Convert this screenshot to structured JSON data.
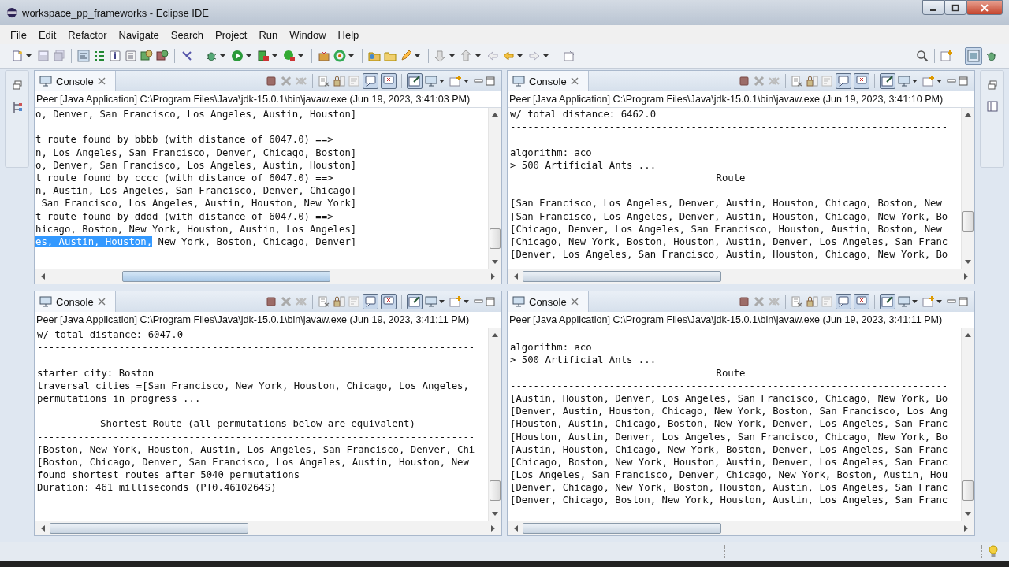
{
  "window": {
    "title": "workspace_pp_frameworks - Eclipse IDE"
  },
  "menu": [
    "File",
    "Edit",
    "Refactor",
    "Navigate",
    "Search",
    "Project",
    "Run",
    "Window",
    "Help"
  ],
  "consoles": [
    {
      "tab": "Console",
      "header": "Peer [Java Application] C:\\Program Files\\Java\\jdk-15.0.1\\bin\\javaw.exe  (Jun 19, 2023, 3:41:03 PM)",
      "scrolled_right": true,
      "show_stdout": true,
      "show_stderr": true,
      "pinned": true,
      "lines": [
        {
          "kind": "output",
          "text": "o, Denver, San Francisco, Los Angeles, Austin, Houston]"
        },
        {
          "kind": "blank"
        },
        {
          "kind": "output",
          "text": "t route found by bbbb (with distance of 6047.0) ==>"
        },
        {
          "kind": "output",
          "text": "n, Los Angeles, San Francisco, Denver, Chicago, Boston]"
        },
        {
          "kind": "output",
          "text": "o, Denver, San Francisco, Los Angeles, Austin, Houston]"
        },
        {
          "kind": "output",
          "text": "t route found by cccc (with distance of 6047.0) ==>"
        },
        {
          "kind": "output",
          "text": "n, Austin, Los Angeles, San Francisco, Denver, Chicago]"
        },
        {
          "kind": "output",
          "text": " San Francisco, Los Angeles, Austin, Houston, New York]"
        },
        {
          "kind": "output",
          "text": "t route found by dddd (with distance of 6047.0) ==>"
        },
        {
          "kind": "output",
          "text": "hicago, Boston, New York, Houston, Austin, Los Angeles]"
        },
        {
          "kind": "output",
          "selected_text": "es, Austin, Houston,",
          "text": " New York, Boston, Chicago, Denver]"
        }
      ]
    },
    {
      "tab": "Console",
      "header": "Peer [Java Application] C:\\Program Files\\Java\\jdk-15.0.1\\bin\\javaw.exe  (Jun 19, 2023, 3:41:10 PM)",
      "scrolled_right": false,
      "show_stdout": true,
      "show_stderr": true,
      "pinned": true,
      "lines": [
        {
          "kind": "output",
          "text": "w/ total distance: 6462.0"
        },
        {
          "kind": "output",
          "text": "---------------------------------------------------------------------------"
        },
        {
          "kind": "blank"
        },
        {
          "kind": "output",
          "text": "algorithm: aco"
        },
        {
          "kind": "output",
          "text": "> 500 Artificial Ants ..."
        },
        {
          "kind": "centered",
          "text": "Route"
        },
        {
          "kind": "output",
          "text": "---------------------------------------------------------------------------"
        },
        {
          "kind": "output",
          "text": "[San Francisco, Los Angeles, Denver, Austin, Houston, Chicago, Boston, New"
        },
        {
          "kind": "output",
          "text": "[San Francisco, Los Angeles, Denver, Austin, Houston, Chicago, New York, Bo"
        },
        {
          "kind": "output",
          "text": "[Chicago, Denver, Los Angeles, San Francisco, Houston, Austin, Boston, New"
        },
        {
          "kind": "output",
          "text": "[Chicago, New York, Boston, Houston, Austin, Denver, Los Angeles, San Franc"
        },
        {
          "kind": "output",
          "text": "[Denver, Los Angeles, San Francisco, Austin, Houston, Chicago, New York, Bo"
        }
      ]
    },
    {
      "tab": "Console",
      "header": "Peer [Java Application] C:\\Program Files\\Java\\jdk-15.0.1\\bin\\javaw.exe  (Jun 19, 2023, 3:41:11 PM)",
      "scrolled_right": false,
      "show_stdout": true,
      "show_stderr": true,
      "pinned": true,
      "lines": [
        {
          "kind": "output",
          "text": "w/ total distance: 6047.0"
        },
        {
          "kind": "output",
          "text": "---------------------------------------------------------------------------"
        },
        {
          "kind": "blank"
        },
        {
          "kind": "output",
          "text": "starter city: Boston"
        },
        {
          "kind": "output",
          "text": "traversal cities =[San Francisco, New York, Houston, Chicago, Los Angeles,"
        },
        {
          "kind": "output",
          "text": "permutations in progress ..."
        },
        {
          "kind": "blank"
        },
        {
          "kind": "centered",
          "text": "Shortest Route (all permutations below are equivalent)"
        },
        {
          "kind": "output",
          "text": "---------------------------------------------------------------------------"
        },
        {
          "kind": "output",
          "text": "[Boston, New York, Houston, Austin, Los Angeles, San Francisco, Denver, Chi"
        },
        {
          "kind": "output",
          "text": "[Boston, Chicago, Denver, San Francisco, Los Angeles, Austin, Houston, New"
        },
        {
          "kind": "output",
          "text": "found shortest routes after 5040 permutations"
        },
        {
          "kind": "output",
          "text": "Duration: 461 milliseconds (PT0.4610264S)"
        }
      ]
    },
    {
      "tab": "Console",
      "header": "Peer [Java Application] C:\\Program Files\\Java\\jdk-15.0.1\\bin\\javaw.exe  (Jun 19, 2023, 3:41:11 PM)",
      "scrolled_right": false,
      "show_stdout": true,
      "show_stderr": true,
      "pinned": true,
      "lines": [
        {
          "kind": "blank"
        },
        {
          "kind": "output",
          "text": "algorithm: aco"
        },
        {
          "kind": "output",
          "text": "> 500 Artificial Ants ..."
        },
        {
          "kind": "centered",
          "text": "Route"
        },
        {
          "kind": "output",
          "text": "---------------------------------------------------------------------------"
        },
        {
          "kind": "output",
          "text": "[Austin, Houston, Denver, Los Angeles, San Francisco, Chicago, New York, Bo"
        },
        {
          "kind": "output",
          "text": "[Denver, Austin, Houston, Chicago, New York, Boston, San Francisco, Los Ang"
        },
        {
          "kind": "output",
          "text": "[Houston, Austin, Chicago, Boston, New York, Denver, Los Angeles, San Franc"
        },
        {
          "kind": "output",
          "text": "[Houston, Austin, Denver, Los Angeles, San Francisco, Chicago, New York, Bo"
        },
        {
          "kind": "output",
          "text": "[Austin, Houston, Chicago, New York, Boston, Denver, Los Angeles, San Franc"
        },
        {
          "kind": "output",
          "text": "[Chicago, Boston, New York, Houston, Austin, Denver, Los Angeles, San Franc"
        },
        {
          "kind": "output",
          "text": "[Los Angeles, San Francisco, Denver, Chicago, New York, Boston, Austin, Hou"
        },
        {
          "kind": "output",
          "text": "[Denver, Chicago, New York, Boston, Houston, Austin, Los Angeles, San Franc"
        },
        {
          "kind": "output",
          "text": "[Denver, Chicago, Boston, New York, Houston, Austin, Los Angeles, San Franc"
        }
      ]
    }
  ]
}
